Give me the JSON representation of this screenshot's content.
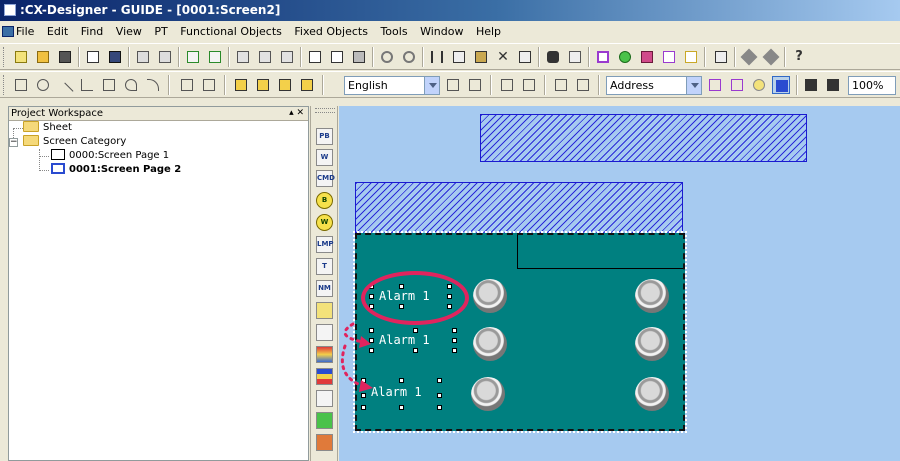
{
  "window": {
    "title": ":CX-Designer - GUIDE - [0001:Screen2]"
  },
  "menu": [
    "File",
    "Edit",
    "Find",
    "View",
    "PT",
    "Functional Objects",
    "Fixed Objects",
    "Tools",
    "Window",
    "Help"
  ],
  "toolbar2": {
    "language_value": "English",
    "address_value": "Address",
    "zoom_value": "100%"
  },
  "workspace": {
    "title": "Project Workspace",
    "controls": "▴ ✕",
    "tree": {
      "sheet": "Sheet",
      "screen_category": "Screen Category",
      "page1": "0000:Screen Page 1",
      "page2": "0001:Screen Page 2"
    }
  },
  "palette": [
    "PB",
    "W",
    "CMD",
    "B",
    "W",
    "LMP",
    "T",
    "NM",
    "",
    "",
    "",
    "",
    "",
    "",
    ""
  ],
  "canvas": {
    "alarms": [
      "Alarm 1",
      "Alarm 1",
      "Alarm 1"
    ]
  },
  "colors": {
    "screen_bg": "#008080",
    "canvas_bg": "#a6caf0",
    "highlight": "#e0245e"
  }
}
